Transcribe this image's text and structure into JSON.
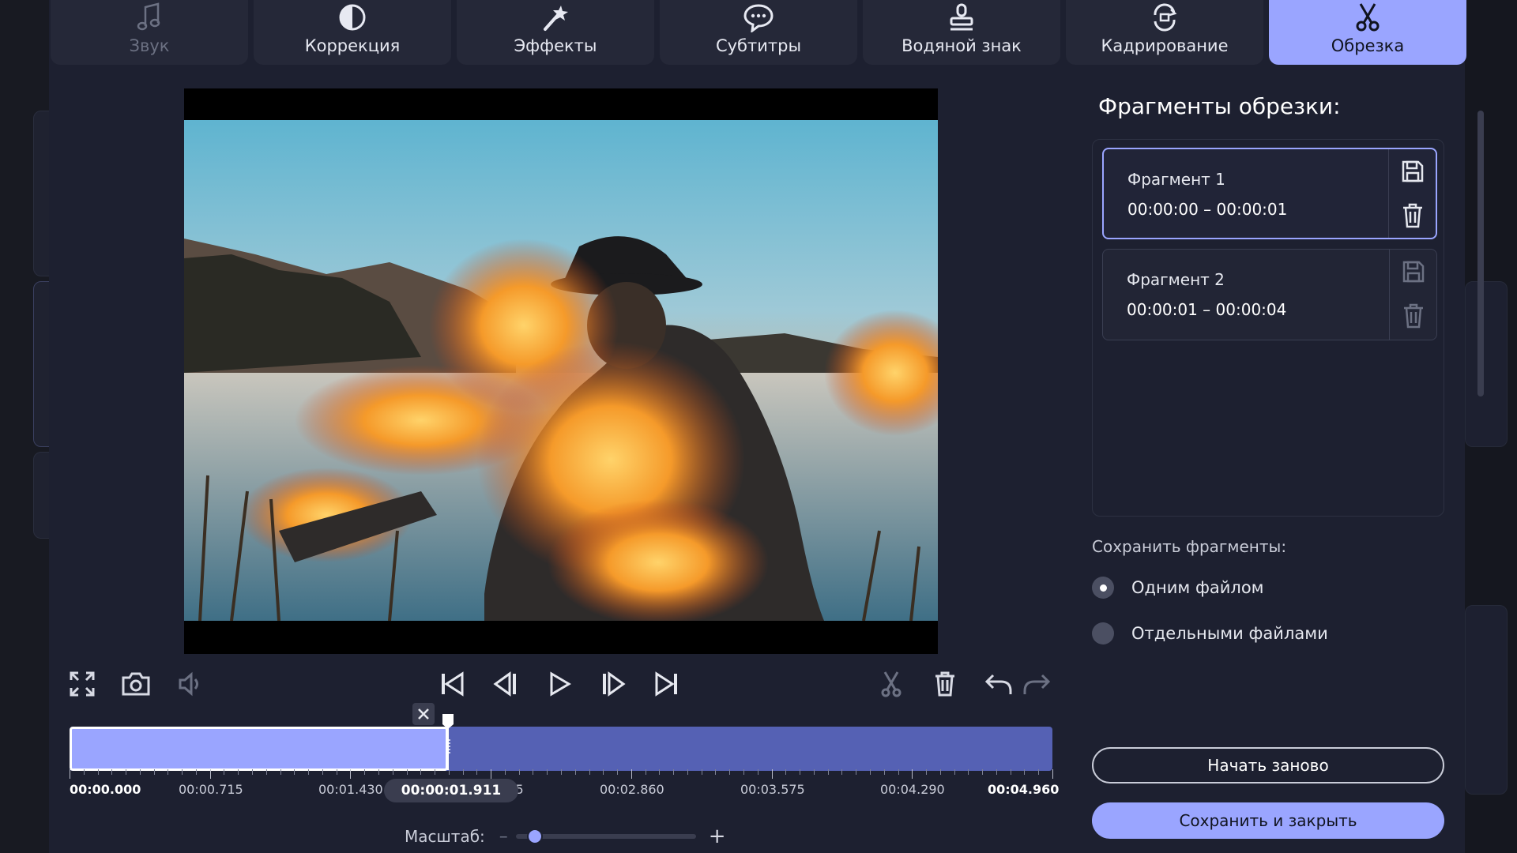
{
  "tabs": [
    {
      "label": "Звук",
      "icon": "music-note-icon"
    },
    {
      "label": "Коррекция",
      "icon": "contrast-icon"
    },
    {
      "label": "Эффекты",
      "icon": "magic-wand-icon"
    },
    {
      "label": "Субтитры",
      "icon": "speech-bubble-icon"
    },
    {
      "label": "Водяной знак",
      "icon": "stamp-icon"
    },
    {
      "label": "Кадрирование",
      "icon": "crop-rotate-icon"
    },
    {
      "label": "Обрезка",
      "icon": "scissors-icon"
    }
  ],
  "active_tab": "Обрезка",
  "timeline": {
    "labels": [
      "00:00.000",
      "00:00.715",
      "00:01.430",
      "00:02.145",
      "00:02.860",
      "00:03.575",
      "00:04.290",
      "00:04.960"
    ],
    "playhead": "00:00:01.911",
    "playhead_fraction": 0.385,
    "zoom_label": "Масштаб:",
    "zoom_fraction": 0.06
  },
  "panel": {
    "title": "Фрагменты обрезки:",
    "fragments": [
      {
        "name": "Фрагмент 1",
        "time": "00:00:00 – 00:00:01",
        "selected": true
      },
      {
        "name": "Фрагмент 2",
        "time": "00:00:01 – 00:00:04",
        "selected": false
      }
    ],
    "save_label": "Сохранить фрагменты:",
    "options": [
      {
        "label": "Одним файлом",
        "checked": true
      },
      {
        "label": "Отдельными файлами",
        "checked": false
      }
    ],
    "restart_label": "Начать заново",
    "save_close_label": "Сохранить и закрыть"
  },
  "colors": {
    "accent": "#9aa5ff",
    "timeline_fill": "#5561b4",
    "background": "#1d2030"
  }
}
